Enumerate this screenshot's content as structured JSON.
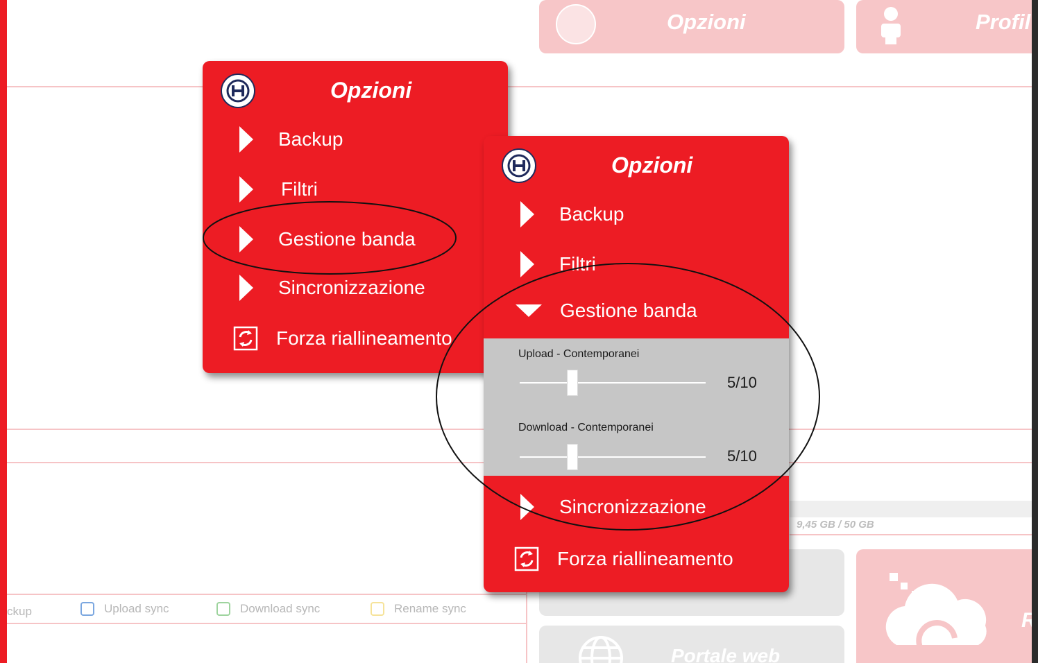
{
  "background_app": {
    "options_button_label": "Opzioni",
    "profile_button_label": "Profil",
    "left_cut_label": "ckup",
    "legend": [
      {
        "label": "Upload sync",
        "color": "#7ba7e0"
      },
      {
        "label": "Download sync",
        "color": "#9ed49e"
      },
      {
        "label": "Rename sync",
        "color": "#f6e39a"
      }
    ],
    "storage_text": "9,45 GB / 50 GB",
    "web_portal_label": "Portale web",
    "cut_r_label": "R"
  },
  "panel_collapsed": {
    "title": "Opzioni",
    "items": [
      {
        "label": "Backup",
        "icon": "arrow-right-icon"
      },
      {
        "label": "Filtri",
        "icon": "arrow-right-icon"
      },
      {
        "label": "Gestione banda",
        "icon": "arrow-right-icon"
      },
      {
        "label": "Sincronizzazione",
        "icon": "arrow-right-icon"
      },
      {
        "label": "Forza riallineamento",
        "icon": "sync-icon"
      }
    ]
  },
  "panel_expanded": {
    "title": "Opzioni",
    "items": [
      {
        "label": "Backup",
        "icon": "arrow-right-icon"
      },
      {
        "label": "Filtri",
        "icon": "arrow-right-icon"
      },
      {
        "label": "Gestione banda",
        "icon": "arrow-down-icon"
      },
      {
        "label": "Sincronizzazione",
        "icon": "arrow-right-icon"
      },
      {
        "label": "Forza riallineamento",
        "icon": "sync-icon"
      }
    ],
    "bandwidth": {
      "upload": {
        "label": "Upload - Contemporanei",
        "value_text": "5/10",
        "value": 5,
        "max": 10
      },
      "download": {
        "label": "Download - Contemporanei",
        "value_text": "5/10",
        "value": 5,
        "max": 10
      }
    }
  },
  "colors": {
    "brand_red": "#ed1c24",
    "faded_red": "#f7c6c8",
    "section_gray": "#c6c6c6"
  }
}
